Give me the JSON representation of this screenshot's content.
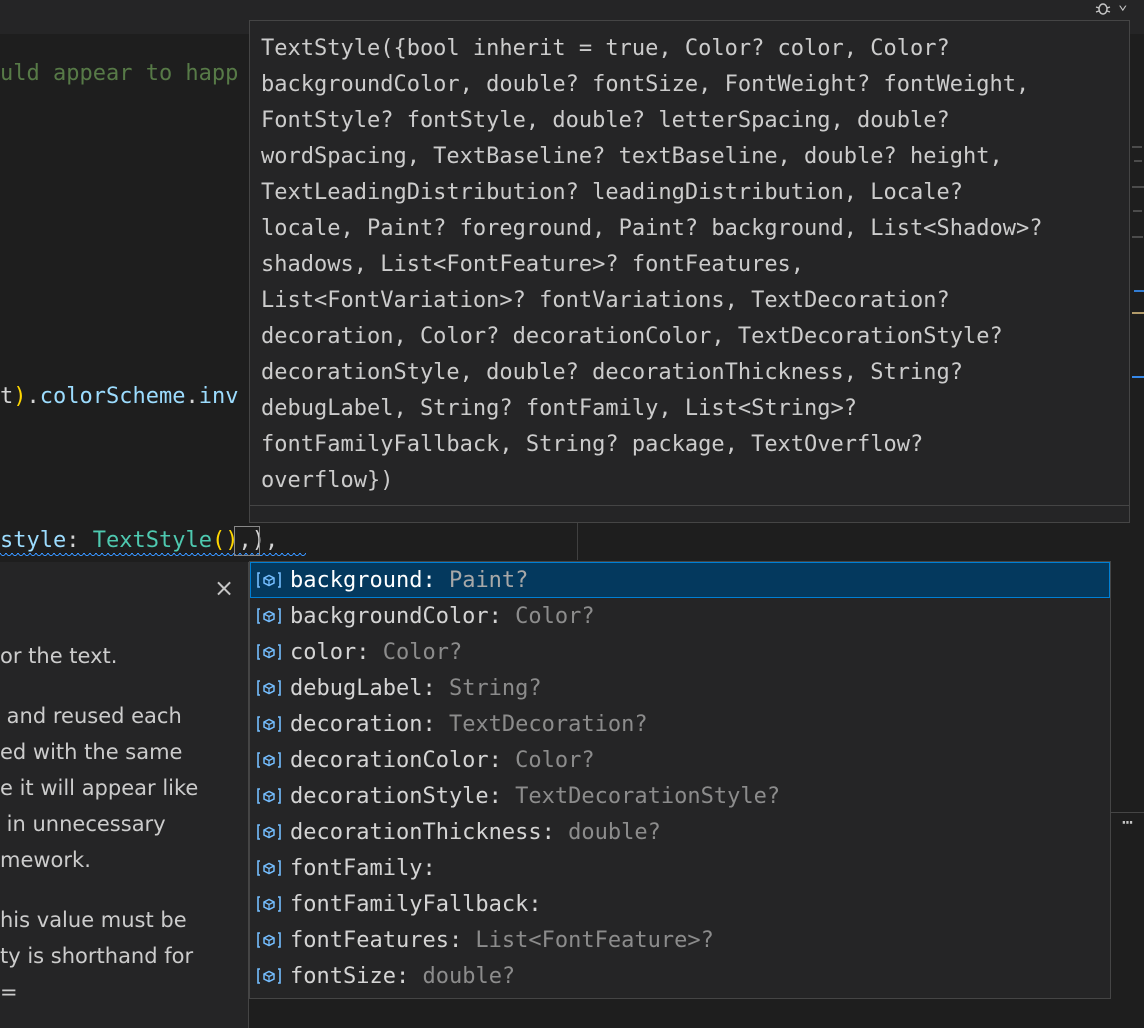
{
  "editor": {
    "comment_line": "uld appear to happ",
    "scheme_line": {
      "prefix": "t",
      "paren": ")",
      "dot1": ".",
      "member": "colorScheme",
      "dot2": ".",
      "tail": "inv"
    },
    "style_line": {
      "prop": "style",
      "colon": ": ",
      "type": "TextStyle",
      "open": "(",
      "close": ")",
      "tail": ",),"
    }
  },
  "signature": {
    "lines": [
      "TextStyle({bool inherit = true, Color? color, Color?",
      "backgroundColor, double? fontSize, FontWeight? fontWeight,",
      "FontStyle? fontStyle, double? letterSpacing, double?",
      "wordSpacing, TextBaseline? textBaseline, double? height,",
      "TextLeadingDistribution? leadingDistribution, Locale?",
      "locale, Paint? foreground, Paint? background, List<Shadow>?",
      "shadows, List<FontFeature>? fontFeatures,",
      "List<FontVariation>? fontVariations, TextDecoration?",
      "decoration, Color? decorationColor, TextDecorationStyle?",
      "decorationStyle, double? decorationThickness, String?",
      "debugLabel, String? fontFamily, List<String>?",
      "fontFamilyFallback, String? package, TextOverflow?",
      "overflow})"
    ]
  },
  "doc_panel": {
    "close_glyph": "×",
    "lines": [
      "or the text.",
      "",
      " and reused each",
      "ed with the same",
      "e it will appear like",
      " in unnecessary",
      "mework.",
      "",
      "his value must be",
      "ty is shorthand for",
      "="
    ]
  },
  "suggestions": [
    {
      "label": "background:",
      "detail": " Paint?",
      "icon": "field-icon"
    },
    {
      "label": "backgroundColor:",
      "detail": " Color?",
      "icon": "field-icon"
    },
    {
      "label": "color:",
      "detail": " Color?",
      "icon": "field-icon"
    },
    {
      "label": "debugLabel:",
      "detail": " String?",
      "icon": "field-icon"
    },
    {
      "label": "decoration:",
      "detail": " TextDecoration?",
      "icon": "field-icon"
    },
    {
      "label": "decorationColor:",
      "detail": " Color?",
      "icon": "field-icon"
    },
    {
      "label": "decorationStyle:",
      "detail": " TextDecorationStyle?",
      "icon": "field-icon"
    },
    {
      "label": "decorationThickness:",
      "detail": " double?",
      "icon": "field-icon"
    },
    {
      "label": "fontFamily:",
      "detail": "",
      "icon": "field-icon"
    },
    {
      "label": "fontFamilyFallback:",
      "detail": "",
      "icon": "field-icon"
    },
    {
      "label": "fontFeatures:",
      "detail": " List<FontFeature>?",
      "icon": "field-icon"
    },
    {
      "label": "fontSize:",
      "detail": " double?",
      "icon": "field-icon"
    }
  ],
  "selected_index": 0,
  "toolbar": {
    "debug_icon": "bug-icon",
    "more_glyph": "⋯"
  },
  "colors": {
    "selection_bg": "#04395e",
    "icon_blue": "#75beff",
    "type_teal": "#4ec9b0",
    "member_blue": "#9cdcfe"
  }
}
